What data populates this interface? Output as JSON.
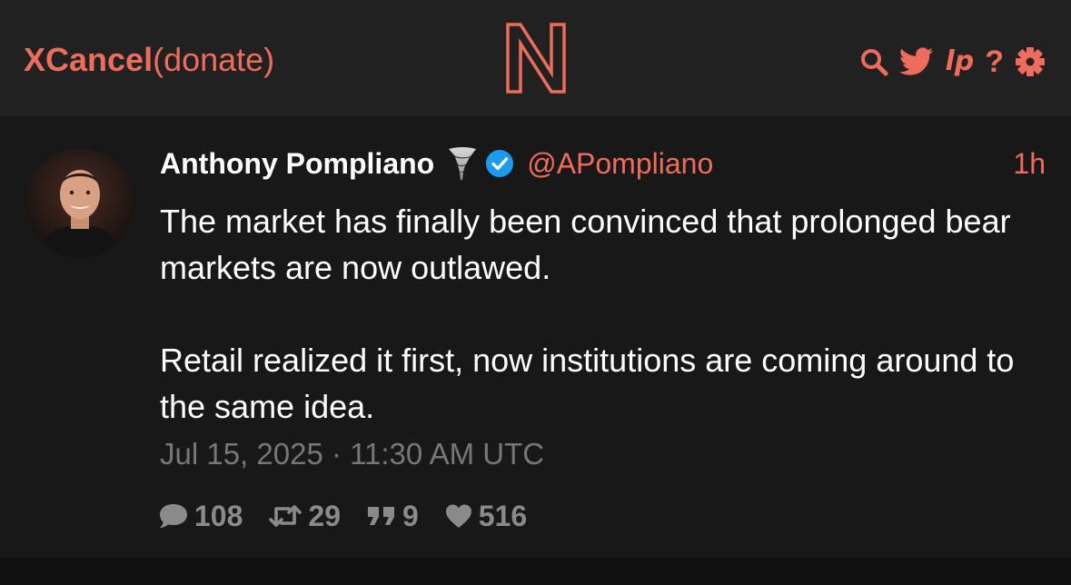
{
  "nav": {
    "brand_name": "XCancel",
    "donate_label": "(donate)",
    "logo_letter": "N",
    "icons": [
      "search-icon",
      "twitter-bird-icon",
      "lp-icon",
      "help-icon",
      "gear-icon"
    ],
    "lp_label": "lp",
    "help_label": "?"
  },
  "tweet": {
    "fullname": "Anthony Pompliano",
    "username": "@APompliano",
    "time_ago": "1h",
    "paragraph1": "The market has finally been convinced that prolonged bear markets are now outlawed.",
    "paragraph2": "Retail realized it first, now institutions are coming around to the same idea.",
    "date": "Jul 15, 2025 · 11:30 AM UTC",
    "stats": {
      "replies": "108",
      "retweets": "29",
      "quotes": "9",
      "likes": "516"
    }
  },
  "colors": {
    "accent": "#ee6c5b",
    "navbar_bg": "#212121",
    "tweet_bg": "#181818",
    "verified": "#1d9bf0"
  }
}
